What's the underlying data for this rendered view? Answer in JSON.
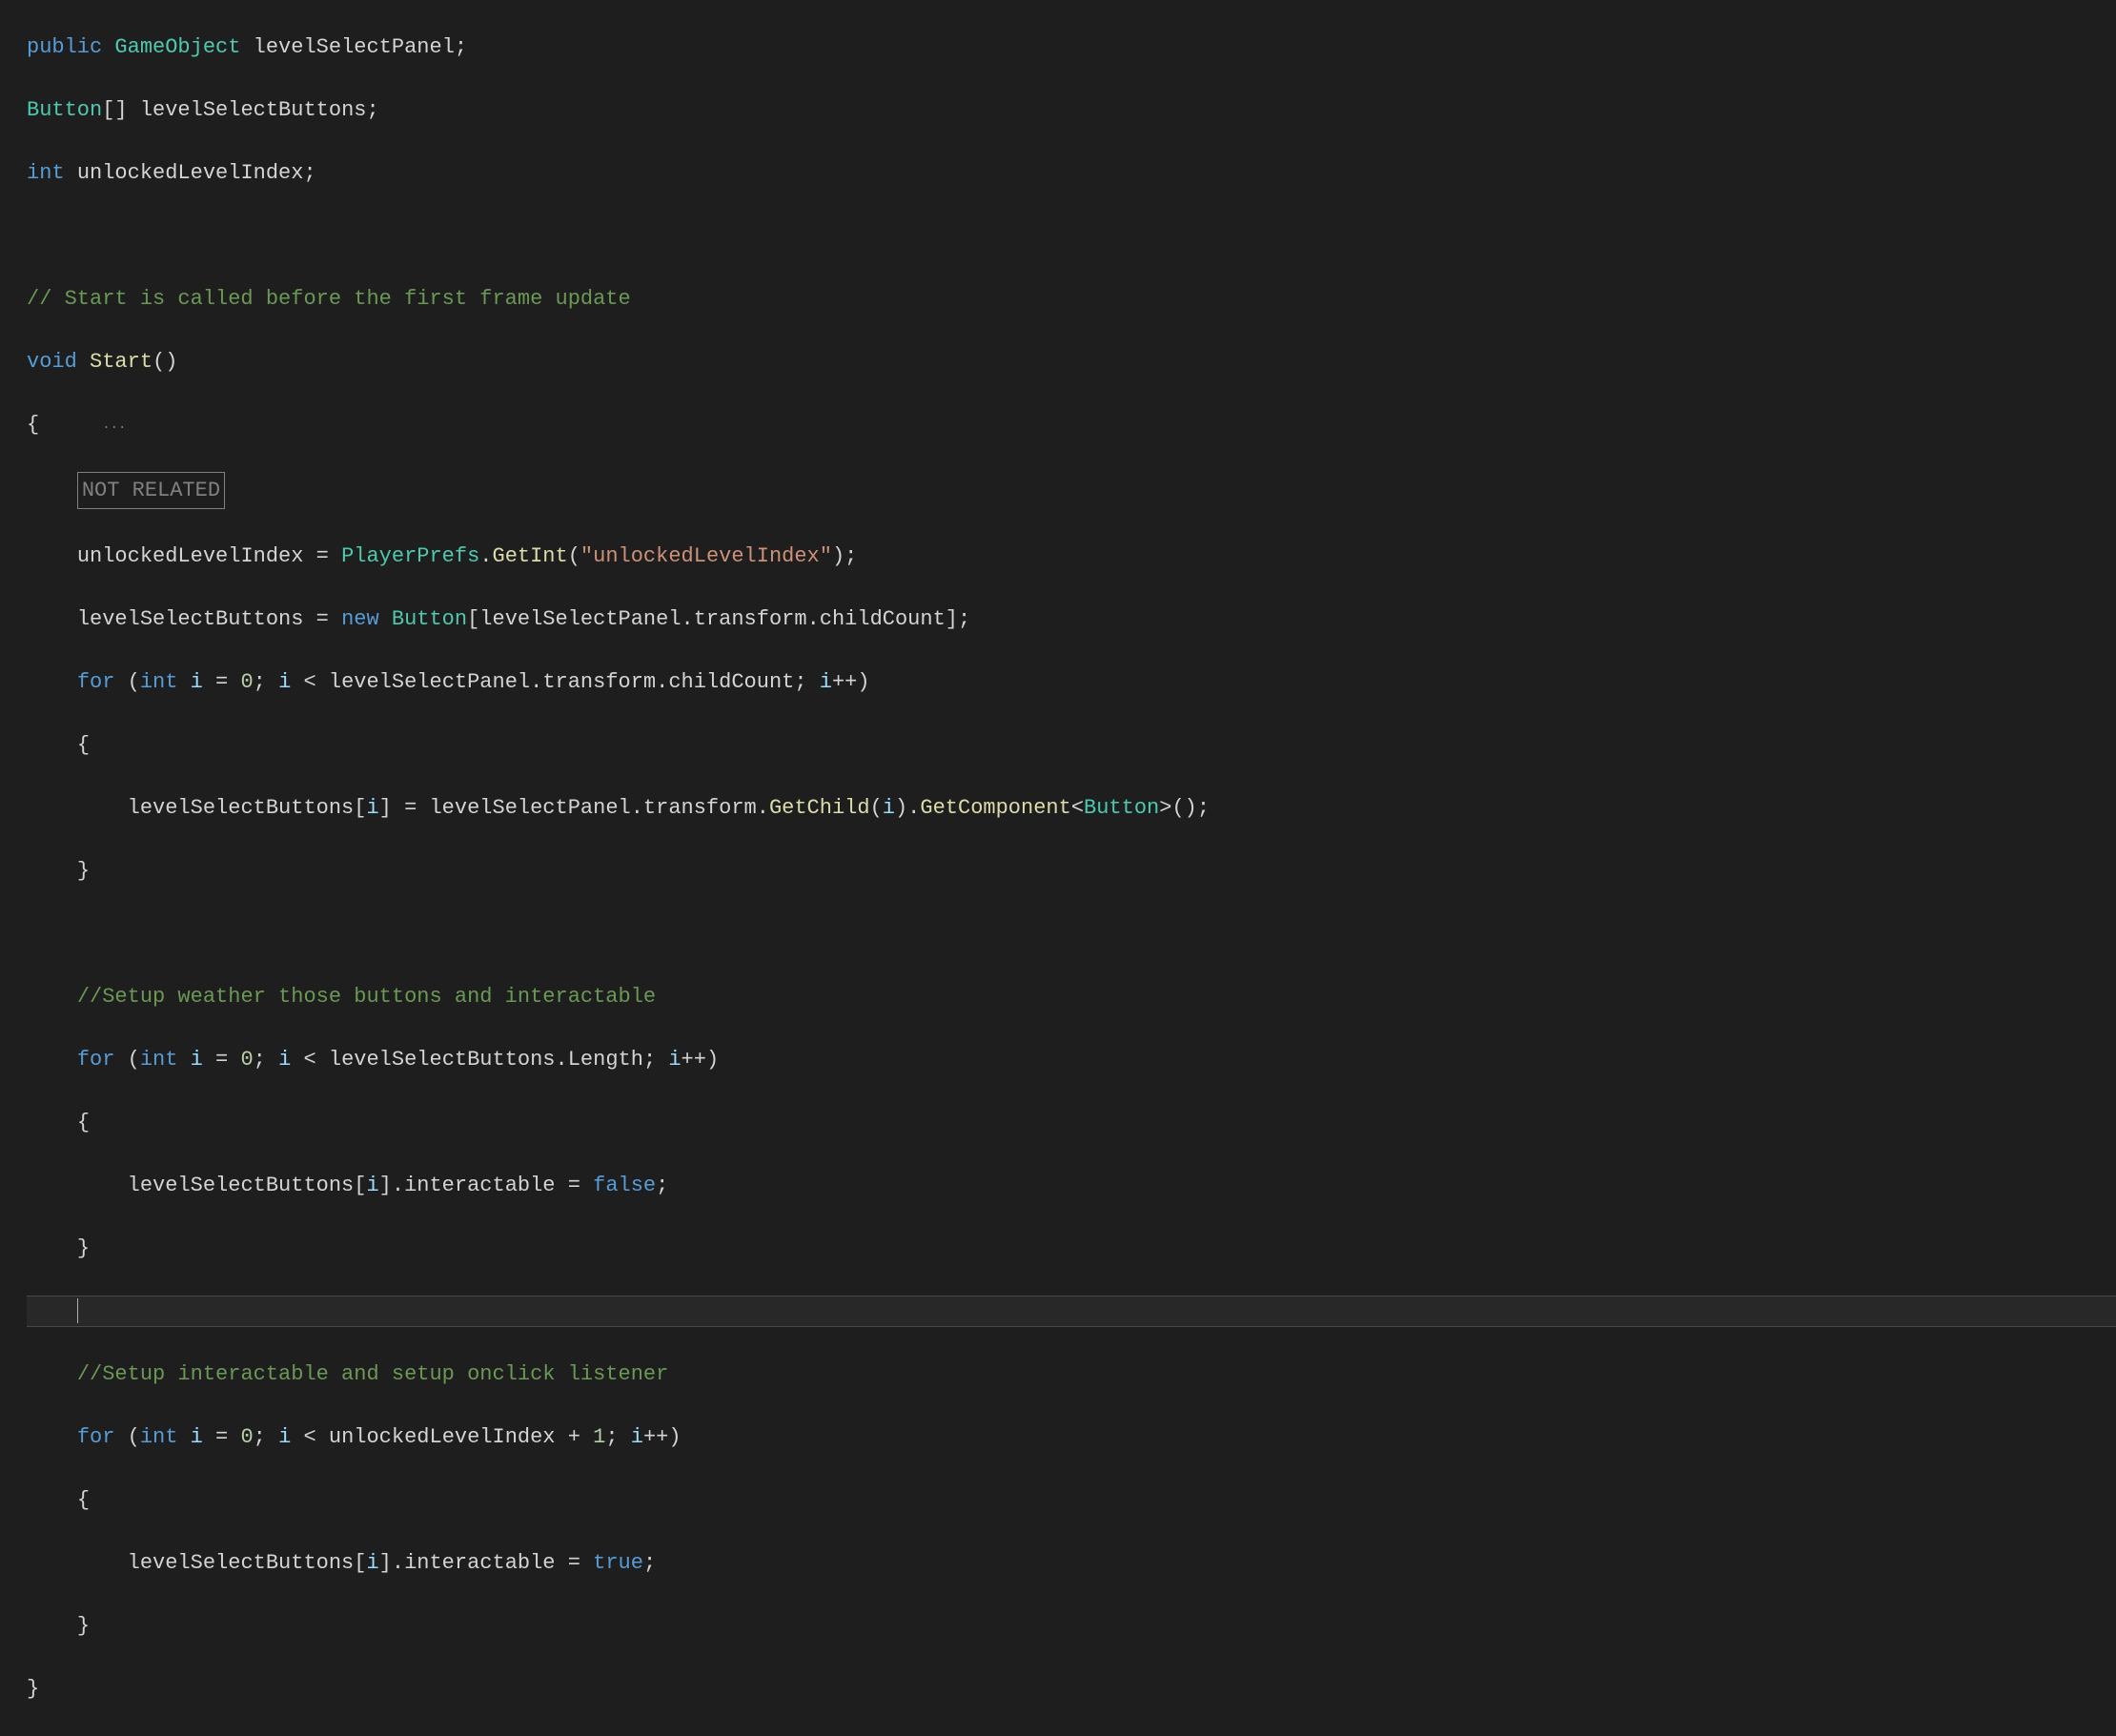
{
  "code": {
    "l1": {
      "public": "public",
      "gameobject": "GameObject",
      "field": "levelSelectPanel",
      "semi": ";"
    },
    "l2": {
      "button": "Button",
      "brackets": "[]",
      "field": "levelSelectButtons",
      "semi": ";"
    },
    "l3": {
      "int": "int",
      "field": "unlockedLevelIndex",
      "semi": ";"
    },
    "l5_comment": "// Start is called before the first frame update",
    "l6": {
      "void": "void",
      "start": "Start",
      "parens": "()"
    },
    "l6_dots": "...",
    "l7_brace": "{",
    "l8_not_related": "NOT RELATED",
    "l9": {
      "lhs": "unlockedLevelIndex",
      "eq": " = ",
      "playerprefs": "PlayerPrefs",
      "dot1": ".",
      "getint": "GetInt",
      "open": "(",
      "str": "\"unlockedLevelIndex\"",
      "close": ")",
      "semi": ";"
    },
    "l10": {
      "lhs": "levelSelectButtons",
      "eq": " = ",
      "new": "new",
      "sp": " ",
      "button": "Button",
      "open": "[",
      "panel": "levelSelectPanel",
      "dot1": ".",
      "transform": "transform",
      "dot2": ".",
      "childcount": "childCount",
      "close": "]",
      "semi": ";"
    },
    "l11": {
      "for": "for",
      "sp": " (",
      "int": "int",
      "sp2": " ",
      "i1": "i",
      "eq": " = ",
      "zero": "0",
      "semi1": "; ",
      "i2": "i",
      "lt": " < ",
      "panel": "levelSelectPanel",
      "dot1": ".",
      "transform": "transform",
      "dot2": ".",
      "childcount": "childCount",
      "semi2": "; ",
      "i3": "i",
      "inc": "++)",
      "close": ""
    },
    "l12_brace": "{",
    "l13": {
      "lhs": "levelSelectButtons",
      "open": "[",
      "i": "i",
      "close": "]",
      "eq": " = ",
      "panel": "levelSelectPanel",
      "dot1": ".",
      "transform": "transform",
      "dot2": ".",
      "getchild": "GetChild",
      "p1": "(",
      "i2": "i",
      "p2": ").",
      "getcomponent": "GetComponent",
      "lt": "<",
      "button": "Button",
      "gt": ">()",
      "semi": ";"
    },
    "l14_brace": "}",
    "l16_comment": "//Setup weather those buttons and interactable",
    "l17": {
      "for": "for",
      "sp": " (",
      "int": "int",
      "sp2": " ",
      "i1": "i",
      "eq": " = ",
      "zero": "0",
      "semi1": "; ",
      "i2": "i",
      "lt": " < ",
      "arr": "levelSelectButtons",
      "dot": ".",
      "length": "Length",
      "semi2": "; ",
      "i3": "i",
      "inc": "++)"
    },
    "l18_brace": "{",
    "l19": {
      "lhs": "levelSelectButtons",
      "open": "[",
      "i": "i",
      "close": "].",
      "interactable": "interactable",
      "eq": " = ",
      "false": "false",
      "semi": ";"
    },
    "l20_brace": "}",
    "l22_comment": "//Setup interactable and setup onclick listener",
    "l23": {
      "for": "for",
      "sp": " (",
      "int": "int",
      "sp2": " ",
      "i1": "i",
      "eq": " = ",
      "zero": "0",
      "semi1": "; ",
      "i2": "i",
      "lt": " < ",
      "idx": "unlockedLevelIndex",
      "plus": " + ",
      "one": "1",
      "semi2": "; ",
      "i3": "i",
      "inc": "++)"
    },
    "l24_brace": "{",
    "l25": {
      "lhs": "levelSelectButtons",
      "open": "[",
      "i": "i",
      "close": "].",
      "interactable": "interactable",
      "eq": " = ",
      "true": "true",
      "semi": ";"
    },
    "l26_brace": "}",
    "l27_brace": "}"
  }
}
